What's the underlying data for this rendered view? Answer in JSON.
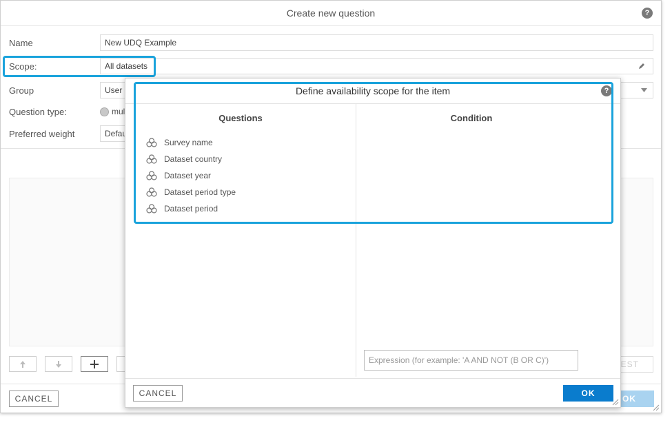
{
  "main": {
    "title": "Create new question",
    "help": "?",
    "name_label": "Name",
    "name_value": "New UDQ Example",
    "scope_label": "Scope:",
    "scope_value": "All datasets",
    "group_label": "Group",
    "group_value": "User",
    "question_type_label": "Question type:",
    "question_type_option": "mul",
    "preferred_weight_label": "Preferred weight",
    "preferred_weight_value": "Defau",
    "test_label": "EST",
    "cancel_label": "CANCEL",
    "ok_label": "OK"
  },
  "scope_dialog": {
    "title": "Define availability scope for the item",
    "help": "?",
    "questions_header": "Questions",
    "condition_header": "Condition",
    "questions": [
      "Survey name",
      "Dataset country",
      "Dataset year",
      "Dataset period type",
      "Dataset period"
    ],
    "expression_placeholder": "Expression (for example: 'A AND NOT (B OR C)')",
    "cancel_label": "CANCEL",
    "ok_label": "OK"
  },
  "colors": {
    "accent": "#0a7ccd",
    "highlight": "#1aa3dc"
  }
}
